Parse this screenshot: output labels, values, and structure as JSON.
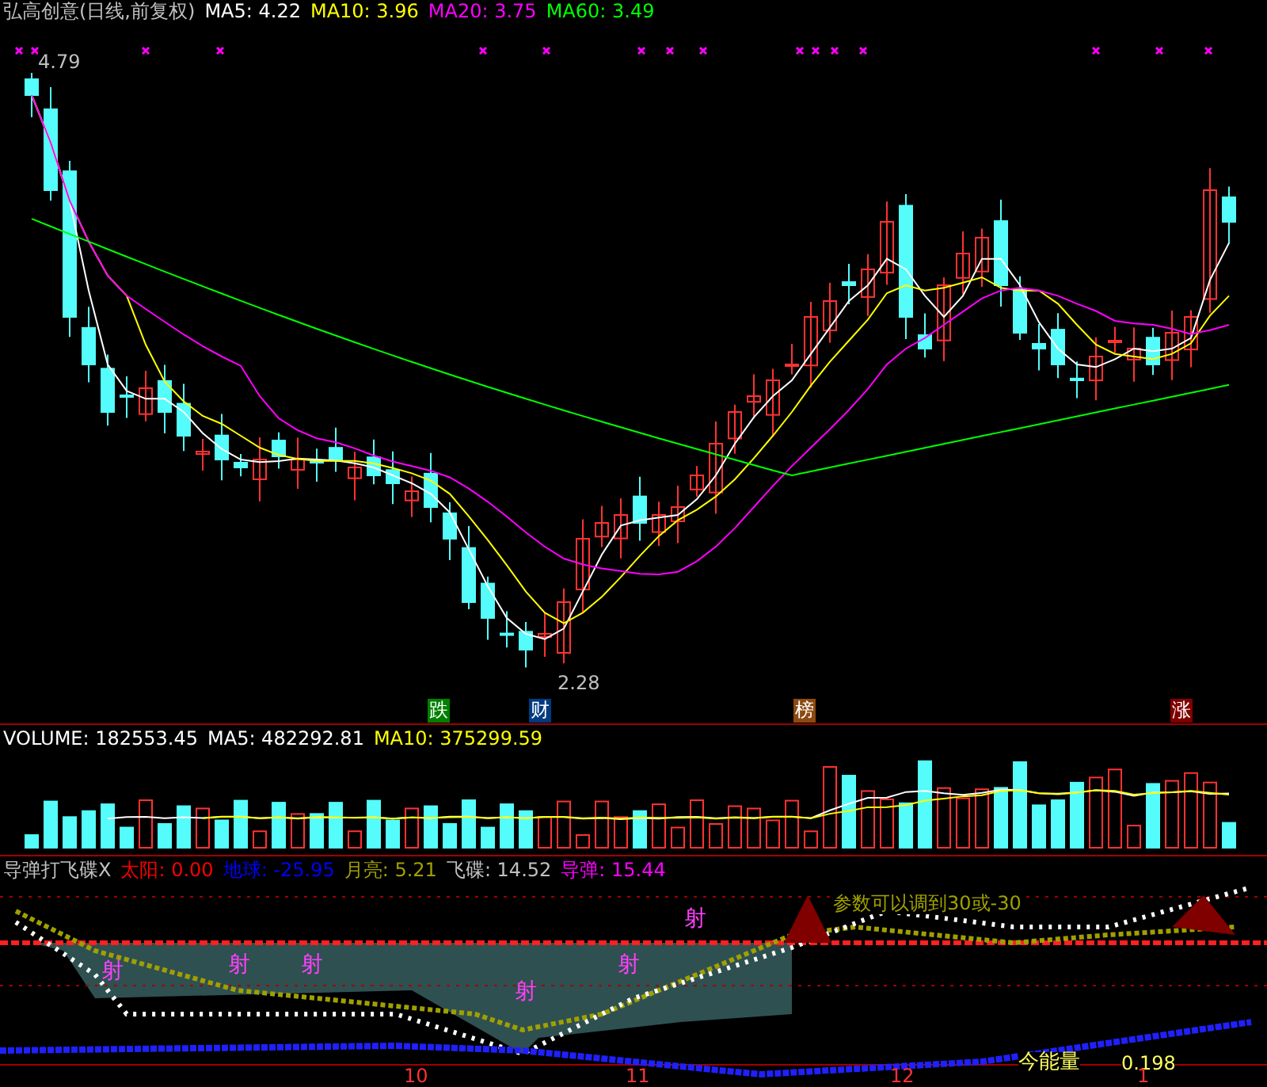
{
  "title": {
    "text": "弘高创意(日线,前复权)"
  },
  "ma_legend": [
    {
      "label": "MA5: 4.22",
      "color": "#ffffff"
    },
    {
      "label": "MA10: 3.96",
      "color": "#ffff00"
    },
    {
      "label": "MA20: 3.75",
      "color": "#ff00ff"
    },
    {
      "label": "MA60: 3.49",
      "color": "#00ff00"
    }
  ],
  "price_labels": [
    {
      "text": "4.79"
    },
    {
      "text": "2.28"
    }
  ],
  "signals": [
    {
      "text": "跌",
      "color": "#008000"
    },
    {
      "text": "财",
      "color": "#003a80"
    },
    {
      "text": "榜",
      "color": "#8b4a10"
    },
    {
      "text": "涨",
      "color": "#800000"
    }
  ],
  "volume_legend": [
    {
      "label": "VOLUME: 182553.45",
      "color": "#ffffff"
    },
    {
      "label": "MA5: 482292.81",
      "color": "#ffffff"
    },
    {
      "label": "MA10: 375299.59",
      "color": "#ffff00"
    }
  ],
  "indicator": {
    "name": "导弹打飞碟X",
    "legend": [
      {
        "label": "太阳: 0.00",
        "color": "#ff0000"
      },
      {
        "label": "地球: -25.95",
        "color": "#0000ff"
      },
      {
        "label": "月亮: 5.21",
        "color": "#a0a000"
      },
      {
        "label": "飞碟: 14.52",
        "color": "#c0c0c0"
      },
      {
        "label": "导弹: 15.44",
        "color": "#ff00ff"
      }
    ],
    "marks": [
      "射",
      "射",
      "射",
      "射",
      "射",
      "射"
    ],
    "note": "参数可以调到30或-30",
    "energy_label": "今能量",
    "energy_value": "0.198"
  },
  "axis": [
    "10",
    "11",
    "12",
    "1"
  ]
}
